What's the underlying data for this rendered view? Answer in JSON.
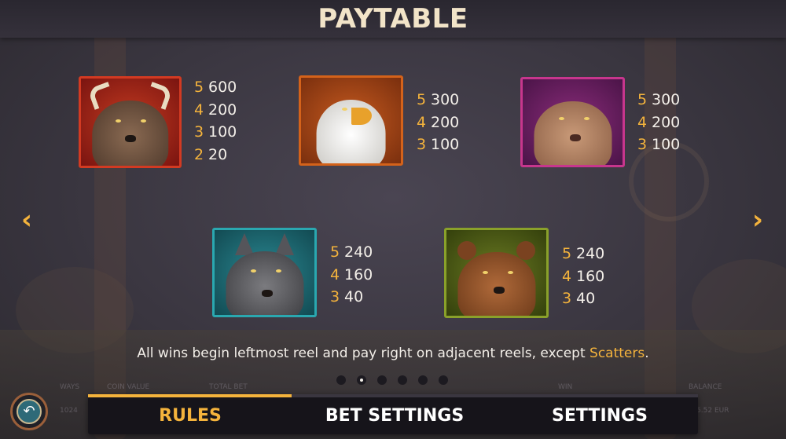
{
  "header": {
    "title": "PAYTABLE"
  },
  "symbols": [
    {
      "name": "bison",
      "frame_color": "#d23a22",
      "pays": [
        {
          "count": "5",
          "amount": "600"
        },
        {
          "count": "4",
          "amount": "200"
        },
        {
          "count": "3",
          "amount": "100"
        },
        {
          "count": "2",
          "amount": "20"
        }
      ]
    },
    {
      "name": "eagle",
      "frame_color": "#d4621a",
      "pays": [
        {
          "count": "5",
          "amount": "300"
        },
        {
          "count": "4",
          "amount": "200"
        },
        {
          "count": "3",
          "amount": "100"
        }
      ]
    },
    {
      "name": "puma",
      "frame_color": "#c7368d",
      "pays": [
        {
          "count": "5",
          "amount": "300"
        },
        {
          "count": "4",
          "amount": "200"
        },
        {
          "count": "3",
          "amount": "100"
        }
      ]
    },
    {
      "name": "wolf",
      "frame_color": "#2aa8b0",
      "pays": [
        {
          "count": "5",
          "amount": "240"
        },
        {
          "count": "4",
          "amount": "160"
        },
        {
          "count": "3",
          "amount": "40"
        }
      ]
    },
    {
      "name": "bear",
      "frame_color": "#8aa12a",
      "pays": [
        {
          "count": "5",
          "amount": "240"
        },
        {
          "count": "4",
          "amount": "160"
        },
        {
          "count": "3",
          "amount": "40"
        }
      ]
    }
  ],
  "navigation": {
    "prev_icon": "chevron-left-icon",
    "next_icon": "chevron-right-icon",
    "prev_glyph": "‹",
    "next_glyph": "›"
  },
  "rule": {
    "text": "All wins begin leftmost reel and pay right on adjacent reels, except ",
    "highlight": "Scatters",
    "end": "."
  },
  "pagination": {
    "pages": 6,
    "current": 2
  },
  "status_bar": {
    "ways_label": "WAYS",
    "ways_value": "1024",
    "coin_value_label": "COIN VALUE",
    "total_bet_label": "TOTAL BET",
    "win_label": "WIN",
    "balance_label": "BALANCE",
    "balance_value": "€2,36.52 EUR"
  },
  "menu": {
    "tabs": [
      "RULES",
      "BET SETTINGS",
      "SETTINGS"
    ],
    "active": "RULES"
  },
  "back_button": {
    "icon": "return-arrow-icon",
    "glyph": "↶"
  },
  "colors": {
    "accent": "#f4b33c",
    "text": "#f3efe9",
    "title": "#f2e4c8",
    "menu_bg": "#16141a"
  }
}
